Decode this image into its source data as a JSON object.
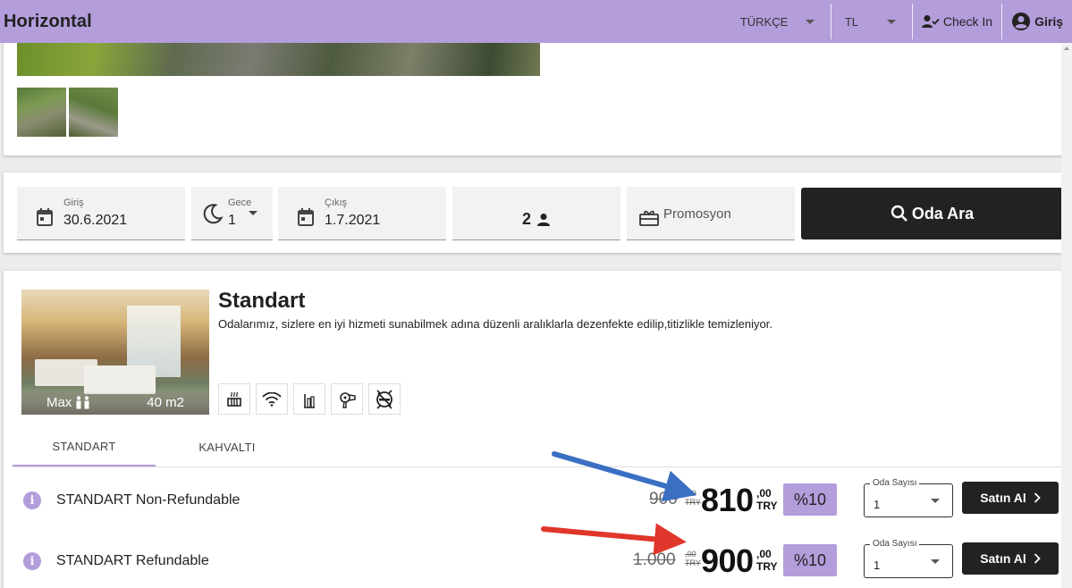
{
  "header": {
    "brand": "Horizontal",
    "language": "TÜRKÇE",
    "currency": "TL",
    "checkin_label": "Check In",
    "login_label": "Giriş",
    "bg_color": "#b39ddb"
  },
  "search": {
    "checkin": {
      "label": "Giriş",
      "value": "30.6.2021",
      "icon": "calendar-icon"
    },
    "nights": {
      "label": "Gece",
      "value": "1",
      "icon": "moon-icon"
    },
    "checkout": {
      "label": "Çıkış",
      "value": "1.7.2021",
      "icon": "calendar-icon"
    },
    "guests": {
      "value": "2",
      "icon": "person-icon"
    },
    "promo": {
      "placeholder": "Promosyon",
      "icon": "gift-card-icon"
    },
    "button_label": "Oda Ara"
  },
  "room": {
    "title": "Standart",
    "description": "Odalarımız, sizlere en iyi hizmeti sunabilmek adına düzenli aralıklarla dezenfekte edilip,titizlikle temizleniyor.",
    "capacity_label": "Max",
    "area": "40 m2",
    "amenities": [
      "heater-icon",
      "wifi-icon",
      "minibar-icon",
      "hair-dryer-icon",
      "no-smoking-icon"
    ],
    "tabs": [
      {
        "label": "STANDART",
        "active": true
      },
      {
        "label": "KAHVALTI",
        "active": false
      }
    ],
    "rates": [
      {
        "name": "STANDART  Non-Refundable",
        "old_price": "900",
        "old_cents": ",00",
        "old_currency": "TRY",
        "new_price": "810",
        "new_cents": ",00",
        "new_currency": "TRY",
        "discount": "%10",
        "qty_label": "Oda Sayısı",
        "qty_value": "1",
        "buy_label": "Satın Al"
      },
      {
        "name": "STANDART  Refundable",
        "old_price": "1.000",
        "old_cents": ",00",
        "old_currency": "TRY",
        "new_price": "900",
        "new_cents": ",00",
        "new_currency": "TRY",
        "discount": "%10",
        "qty_label": "Oda Sayısı",
        "qty_value": "1",
        "buy_label": "Satın Al"
      }
    ]
  },
  "annotations": {
    "arrow_colors": [
      "#3a6fc2",
      "#e0362b"
    ]
  }
}
